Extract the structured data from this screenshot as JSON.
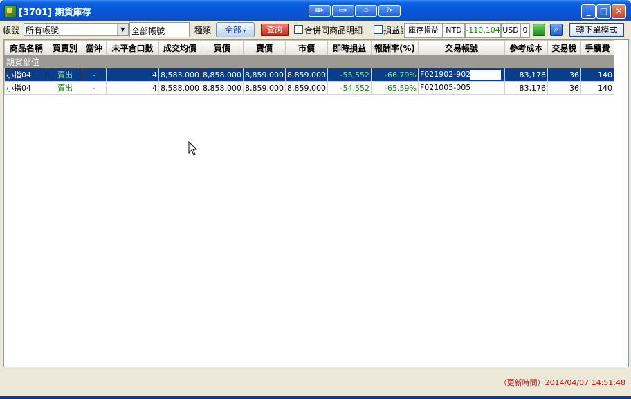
{
  "window": {
    "title": "[3701] 期貨庫存",
    "toolbar_icons": [
      "split-icon",
      "minimize-view-icon",
      "restore-view-icon",
      "help-icon"
    ]
  },
  "toolbar": {
    "account_label": "帳號",
    "account_select": "所有帳號",
    "account_field": "全部帳號",
    "category_label": "種類",
    "all_button": "全部",
    "query_button": "查詢",
    "merge_label": "合併同商品明細",
    "pnl_label": "損益試",
    "inventory_pnl_label": "庫存損益",
    "ntd_label": "NTD",
    "ntd_value": "-110,104",
    "usd_label": "USD",
    "usd_value": "0",
    "switch_button": "轉下單模式"
  },
  "table": {
    "headers": [
      "商品名稱",
      "買賣別",
      "當沖",
      "未平倉口數",
      "成交均價",
      "買價",
      "賣價",
      "市價",
      "即時損益",
      "報酬率(%)",
      "交易帳號",
      "參考成本",
      "交易稅",
      "手續費"
    ],
    "group_label": "期貨部位",
    "rows": [
      [
        "小指04",
        "賣出",
        "-",
        "4",
        "8,583.000",
        "8,858.000",
        "8,859.000",
        "8,859.000",
        "-55,552",
        "-66.79%",
        "F021902-902",
        "83,176",
        "36",
        "140"
      ],
      [
        "小指04",
        "賣出",
        "-",
        "4",
        "8,588.000",
        "8,858.000",
        "8,859.000",
        "8,859.000",
        "-54,552",
        "-65.59%",
        "F021005-005",
        "83,176",
        "36",
        "140"
      ]
    ]
  },
  "status": {
    "updated": "（更新時間）2014/04/07 14:51:48"
  },
  "colors": {
    "titlebar": "#0856D8",
    "selected_row": "#0A3D8C",
    "loss_green": "#12820C",
    "status_red": "#C8140E"
  }
}
